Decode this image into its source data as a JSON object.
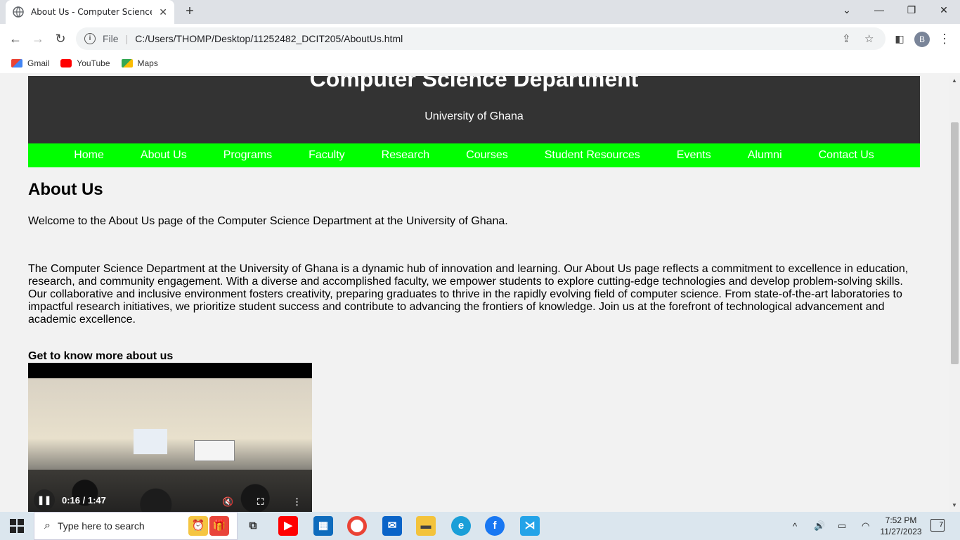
{
  "browser": {
    "tab_title": "About Us - Computer Science D",
    "address_scheme": "File",
    "address_url": "C:/Users/THOMP/Desktop/11252482_DCIT205/AboutUs.html",
    "profile_initial": "B",
    "bookmarks": [
      {
        "label": "Gmail",
        "icon": "gmail-icon",
        "color": "#ea4335"
      },
      {
        "label": "YouTube",
        "icon": "youtube-icon",
        "color": "#ff0000"
      },
      {
        "label": "Maps",
        "icon": "maps-icon",
        "color": "#34a853"
      }
    ]
  },
  "site": {
    "title": "Computer Science Department",
    "subtitle": "University of Ghana",
    "header_color": "#333333",
    "nav_color": "#00ff00",
    "nav": [
      "Home",
      "About Us",
      "Programs",
      "Faculty",
      "Research",
      "Courses",
      "Student Resources",
      "Events",
      "Alumni",
      "Contact Us"
    ]
  },
  "page": {
    "heading": "About Us",
    "welcome": "Welcome to the About Us page of the Computer Science Department at the University of Ghana.",
    "body": "The Computer Science Department at the University of Ghana is a dynamic hub of innovation and learning. Our About Us page reflects a commitment to excellence in education, research, and community engagement. With a diverse and accomplished faculty, we empower students to explore cutting-edge technologies and develop problem-solving skills. Our collaborative and inclusive environment fosters creativity, preparing graduates to thrive in the rapidly evolving field of computer science. From state-of-the-art laboratories to impactful research initiatives, we prioritize student success and contribute to advancing the frontiers of knowledge. Join us at the forefront of technological advancement and academic excellence.",
    "video_heading": "Get to know more about us",
    "video_time": "0:16 / 1:47"
  },
  "taskbar": {
    "search_placeholder": "Type here to search",
    "time": "7:52 PM",
    "date": "11/27/2023",
    "notifications": "7"
  }
}
